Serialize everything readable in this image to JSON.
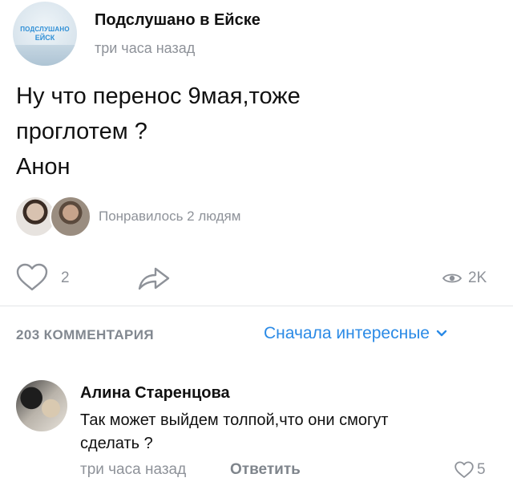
{
  "post": {
    "group_name": "Подслушано в Ейске",
    "time": "три часа назад",
    "avatar_logo": [
      "ПОДСЛУШАНО",
      "ЕЙСК"
    ],
    "text_lines": [
      "Ну что перенос 9мая,тоже",
      "проглотем ?",
      "Анон"
    ],
    "likes_summary": "Понравилось 2 людям",
    "like_count": "2",
    "views": "2K"
  },
  "comments": {
    "count_label": "203 КОММЕНТАРИЯ",
    "sort_label": "Сначала интересные",
    "items": [
      {
        "author": "Алина Старенцова",
        "text_lines": [
          "Так может выйдем толпой,что они смогут",
          "сделать ?"
        ],
        "time": "три часа назад",
        "reply_label": "Ответить",
        "likes": "5"
      }
    ]
  },
  "icons": {
    "like": "heart-icon",
    "share": "share-arrow-icon",
    "views": "eye-icon",
    "sort": "chevron-down-icon"
  },
  "colors": {
    "accent": "#2a8ae6",
    "secondary_text": "#8e9299",
    "divider": "#e3e5e8"
  }
}
